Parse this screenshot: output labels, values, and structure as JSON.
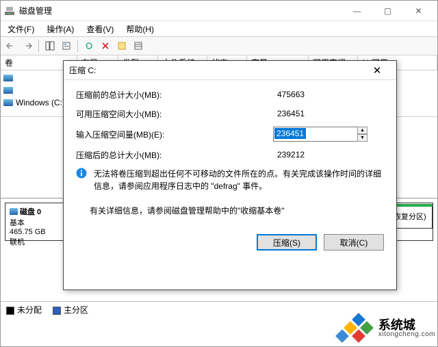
{
  "window": {
    "title": "磁盘管理",
    "controls": {
      "min": "—",
      "max": "▢",
      "close": "✕"
    }
  },
  "menu": {
    "file": "文件(F)",
    "action": "操作(A)",
    "view": "查看(V)",
    "help": "帮助(H)"
  },
  "headers": {
    "volume": "卷",
    "layout": "布局",
    "type": "类型",
    "filesystem": "文件系统",
    "status": "状态",
    "capacity": "容量",
    "free": "可用空间",
    "pctfree": "% 可用"
  },
  "volumes": {
    "v1": "",
    "v2": "",
    "v3": "Windows (C:)"
  },
  "disk": {
    "name": "磁盘 0",
    "type": "基本",
    "size": "465.75 GB",
    "status": "联机"
  },
  "recovery_label": "恢复分区)",
  "legend": {
    "unallocated": "未分配",
    "primary": "主分区"
  },
  "dialog": {
    "title": "压缩 C:",
    "close": "✕",
    "label_total_before": "压缩前的总计大小(MB):",
    "value_total_before": "475663",
    "label_shrink_avail": "可用压缩空间大小(MB):",
    "value_shrink_avail": "236451",
    "label_shrink_amount": "输入压缩空间量(MB)(E):",
    "value_shrink_amount": "236451",
    "label_total_after": "压缩后的总计大小(MB):",
    "value_total_after": "239212",
    "info_text": "无法将卷压缩到超出任何不可移动的文件所在的点。有关完成该操作时间的详细信息，请参阅应用程序日志中的 \"defrag\" 事件。",
    "help_text": "有关详细信息，请参阅磁盘管理帮助中的\"收缩基本卷\"",
    "btn_shrink": "压缩(S)",
    "btn_cancel": "取消(C)"
  },
  "watermark": {
    "cn": "系统城",
    "en": "xitongcheng.com"
  }
}
